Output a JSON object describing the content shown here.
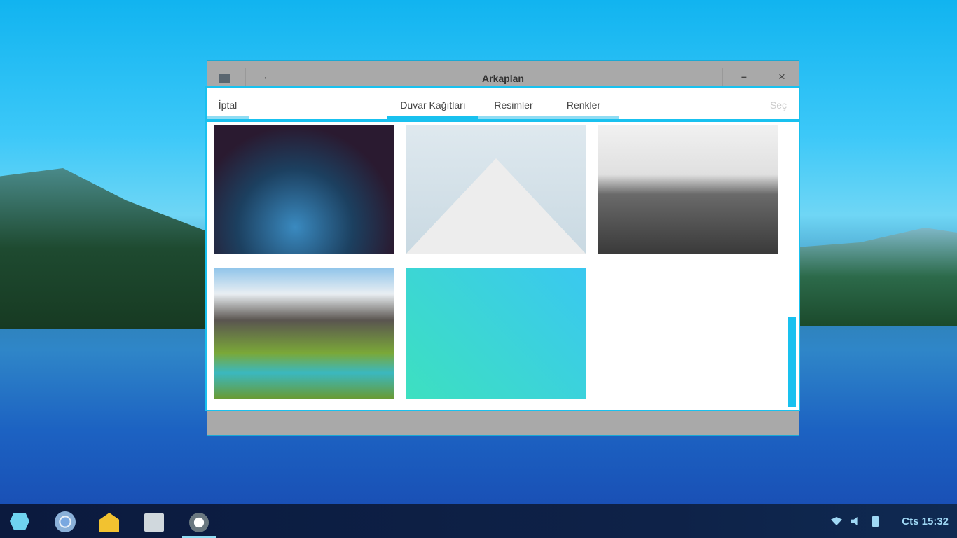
{
  "window": {
    "title": "Arkaplan",
    "minimize": "–",
    "close": "×",
    "back": "←"
  },
  "dialog": {
    "cancel": "İptal",
    "select": "Seç",
    "tabs": [
      {
        "label": "Duvar Kağıtları",
        "active": true
      },
      {
        "label": "Resimler"
      },
      {
        "label": "Renkler"
      }
    ]
  },
  "wallpapers": [
    "nebula",
    "white-building",
    "foggy-sea",
    "mountain-lake",
    "teal-gradient"
  ],
  "taskbar": {
    "clock": "Cts 15:32",
    "apps": [
      "zorin-menu",
      "chromium",
      "mail",
      "files",
      "settings"
    ]
  },
  "colors": {
    "accent": "#19c1ef"
  }
}
